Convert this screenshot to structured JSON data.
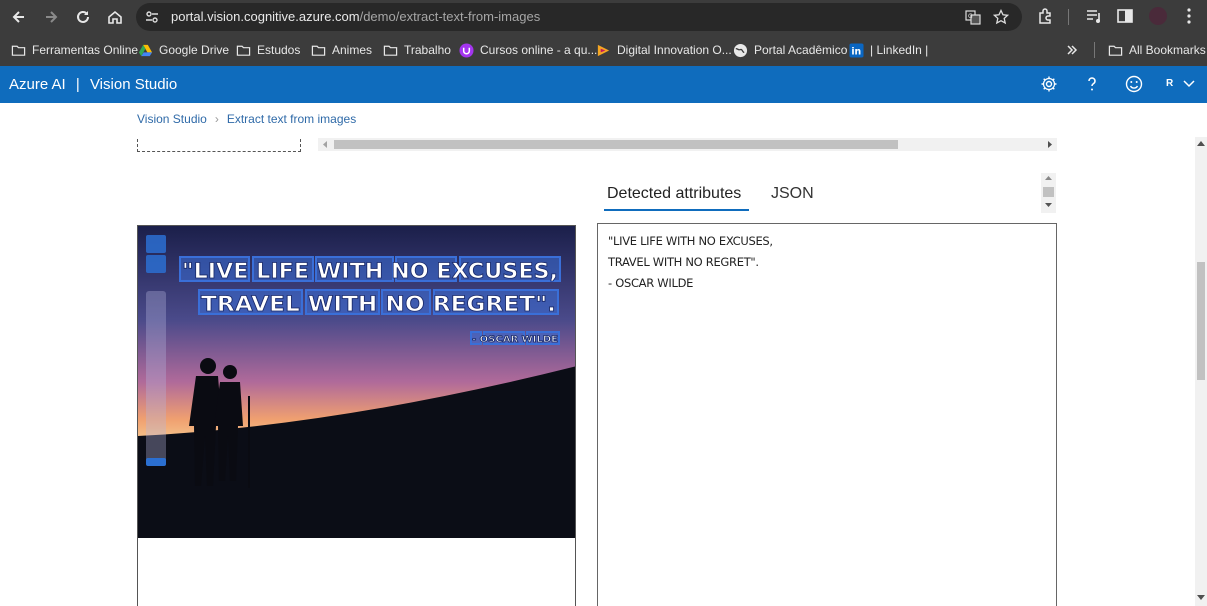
{
  "browser": {
    "url_host": "portal.vision.cognitive.azure.com",
    "url_path": "/demo/extract-text-from-images",
    "profile_initial": "R"
  },
  "bookmarks": [
    {
      "label": "Ferramentas Online",
      "icon": "folder-icon"
    },
    {
      "label": "Google Drive",
      "icon": "google-drive-icon"
    },
    {
      "label": "Estudos",
      "icon": "folder-icon"
    },
    {
      "label": "Animes",
      "icon": "folder-icon"
    },
    {
      "label": "Trabalho",
      "icon": "folder-icon"
    },
    {
      "label": "Cursos online - a qu...",
      "icon": "udemy-icon"
    },
    {
      "label": "Digital Innovation O...",
      "icon": "dio-icon"
    },
    {
      "label": "Portal Acadêmico",
      "icon": "globe-icon"
    },
    {
      "label": "| LinkedIn |",
      "icon": "linkedin-icon"
    }
  ],
  "all_bookmarks_label": "All Bookmarks",
  "app": {
    "brand": "Azure AI",
    "divider": "|",
    "product": "Vision Studio",
    "user_initial": "R"
  },
  "breadcrumb": {
    "root": "Vision Studio",
    "current": "Extract text from images"
  },
  "tabs": [
    {
      "label": "Detected attributes",
      "active": true
    },
    {
      "label": "JSON",
      "active": false
    }
  ],
  "image": {
    "quote_line1": "\"LIVE LIFE WITH NO EXCUSES,",
    "quote_line2": "TRAVEL WITH NO REGRET\".",
    "author": "- OSCAR WILDE"
  },
  "results": {
    "lines": [
      "\"LIVE LIFE WITH NO EXCUSES,",
      "TRAVEL WITH NO REGRET\".",
      "- OSCAR WILDE"
    ]
  },
  "colors": {
    "azure_blue": "#0f6cbd",
    "chrome_dark": "#3c3c3c",
    "link_blue": "#2f6aa8",
    "highlight_box": "#3a6fd8"
  }
}
